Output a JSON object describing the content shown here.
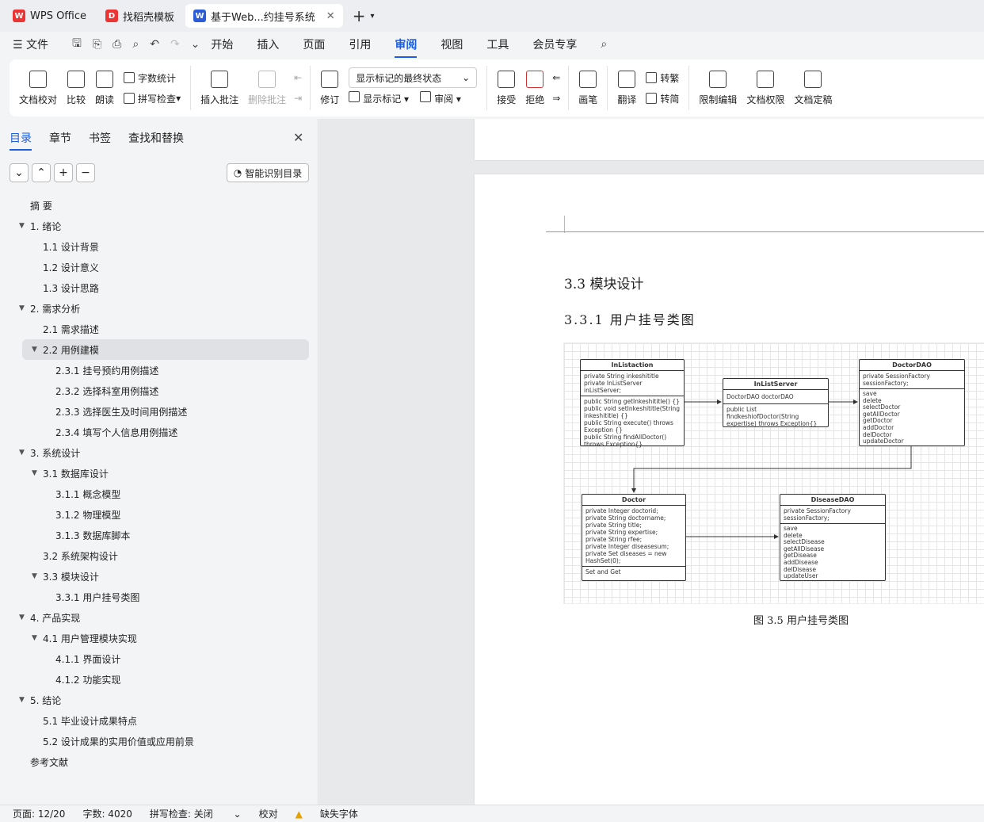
{
  "tabs": [
    {
      "label": "WPS Office",
      "icon": "wps-logo-icon",
      "color": "#e33"
    },
    {
      "label": "找稻壳模板",
      "icon": "docer-icon",
      "color": "#e33"
    },
    {
      "label": "基于Web...约挂号系统",
      "icon": "word-doc-icon",
      "color": "#2b5cd9"
    }
  ],
  "menu": {
    "file": "文件",
    "items": [
      "开始",
      "插入",
      "页面",
      "引用",
      "审阅",
      "视图",
      "工具",
      "会员专享"
    ],
    "active": "审阅"
  },
  "ribbon": {
    "proofread": "文档校对",
    "compare": "比较",
    "read": "朗读",
    "wordcount": "字数统计",
    "spellcheck": "拼写检查",
    "insert_comment": "插入批注",
    "delete_comment": "删除批注",
    "track": "修订",
    "show_markup": "显示标记",
    "display_state": "显示标记的最终状态",
    "review": "审阅",
    "accept": "接受",
    "reject": "拒绝",
    "pen": "画笔",
    "translate": "翻译",
    "to_traditional": "转繁",
    "to_simplified": "转简",
    "restrict": "限制编辑",
    "permission": "文档权限",
    "finalize": "文档定稿"
  },
  "panel": {
    "tabs": [
      "目录",
      "章节",
      "书签",
      "查找和替换"
    ],
    "smart": "智能识别目录"
  },
  "toc": [
    {
      "t": "摘  要",
      "l": 0,
      "tri": ""
    },
    {
      "t": "1.  绪论",
      "l": 0,
      "tri": "▼"
    },
    {
      "t": "1.1 设计背景",
      "l": 1,
      "tri": ""
    },
    {
      "t": "1.2 设计意义",
      "l": 1,
      "tri": ""
    },
    {
      "t": "1.3 设计思路",
      "l": 1,
      "tri": ""
    },
    {
      "t": "2.  需求分析",
      "l": 0,
      "tri": "▼"
    },
    {
      "t": "2.1  需求描述",
      "l": 1,
      "tri": ""
    },
    {
      "t": "2.2  用例建模",
      "l": 1,
      "tri": "▼",
      "sel": true
    },
    {
      "t": "2.3.1  挂号预约用例描述",
      "l": 2,
      "tri": ""
    },
    {
      "t": "2.3.2 选择科室用例描述",
      "l": 2,
      "tri": ""
    },
    {
      "t": "2.3.3  选择医生及时间用例描述",
      "l": 2,
      "tri": ""
    },
    {
      "t": "2.3.4  填写个人信息用例描述",
      "l": 2,
      "tri": ""
    },
    {
      "t": "3.  系统设计",
      "l": 0,
      "tri": "▼"
    },
    {
      "t": "3.1  数据库设计",
      "l": 1,
      "tri": "▼"
    },
    {
      "t": "3.1.1  概念模型",
      "l": 2,
      "tri": ""
    },
    {
      "t": "3.1.2  物理模型",
      "l": 2,
      "tri": ""
    },
    {
      "t": "3.1.3  数据库脚本",
      "l": 2,
      "tri": ""
    },
    {
      "t": "3.2  系统架构设计",
      "l": 1,
      "tri": ""
    },
    {
      "t": "3.3  模块设计",
      "l": 1,
      "tri": "▼"
    },
    {
      "t": "3.3.1 用户挂号类图",
      "l": 2,
      "tri": ""
    },
    {
      "t": "4.  产品实现",
      "l": 0,
      "tri": "▼"
    },
    {
      "t": "4.1  用户管理模块实现",
      "l": 1,
      "tri": "▼"
    },
    {
      "t": "4.1.1  界面设计",
      "l": 2,
      "tri": ""
    },
    {
      "t": "4.1.2  功能实现",
      "l": 2,
      "tri": ""
    },
    {
      "t": "5.  结论",
      "l": 0,
      "tri": "▼"
    },
    {
      "t": "5.1 毕业设计成果特点",
      "l": 1,
      "tri": ""
    },
    {
      "t": "5.2 设计成果的实用价值或应用前景",
      "l": 1,
      "tri": ""
    },
    {
      "t": "参考文献",
      "l": 0,
      "tri": ""
    }
  ],
  "doc": {
    "h2": "3.3  模块设计",
    "h3": "3.3.1 用户挂号类图",
    "caption": "图 3.5  用户挂号类图",
    "classes": {
      "inlistaction": {
        "name": "InListaction",
        "attrs": [
          "private String inkeshititle",
          "private InListServer inListServer;"
        ],
        "ops": [
          "public String getInkeshititle() {}",
          "public void setInkeshititle(String",
          "inkeshititle) {}",
          "public String execute() throws",
          "Exception {}",
          "public String findAllDoctor()",
          "throws Exception{}"
        ]
      },
      "inlistserver": {
        "name": "InListServer",
        "attrs": [
          "DoctorDAO doctorDAO"
        ],
        "ops": [
          "public List",
          "findkeshiofDoctor(String",
          "expertise) throws Exception{}"
        ]
      },
      "doctordao": {
        "name": "DoctorDAO",
        "attrs": [
          "private SessionFactory",
          "sessionFactory;"
        ],
        "ops": [
          "save",
          "delete",
          "selectDoctor",
          "getAllDoctor",
          "getDoctor",
          "addDoctor",
          "delDoctor",
          "updateDoctor"
        ]
      },
      "doctor": {
        "name": "Doctor",
        "attrs": [
          "private Integer doctorid;",
          "private String doctorname;",
          "private String title;",
          "private String expertise;",
          "private String rfee;",
          "private Integer diseasesum;",
          "private Set diseases = new",
          "HashSet(0);"
        ],
        "ops": [
          "Set and Get"
        ]
      },
      "diseasedao": {
        "name": "DiseaseDAO",
        "attrs": [
          "private SessionFactory",
          "sessionFactory;"
        ],
        "ops": [
          "save",
          "delete",
          "selectDisease",
          "getAllDisease",
          "getDisease",
          "addDisease",
          "delDisease",
          "updateUser"
        ]
      }
    }
  },
  "status": {
    "page": "页面: 12/20",
    "words": "字数: 4020",
    "spell": "拼写检查: 关闭",
    "proof": "校对",
    "font": "缺失字体"
  }
}
